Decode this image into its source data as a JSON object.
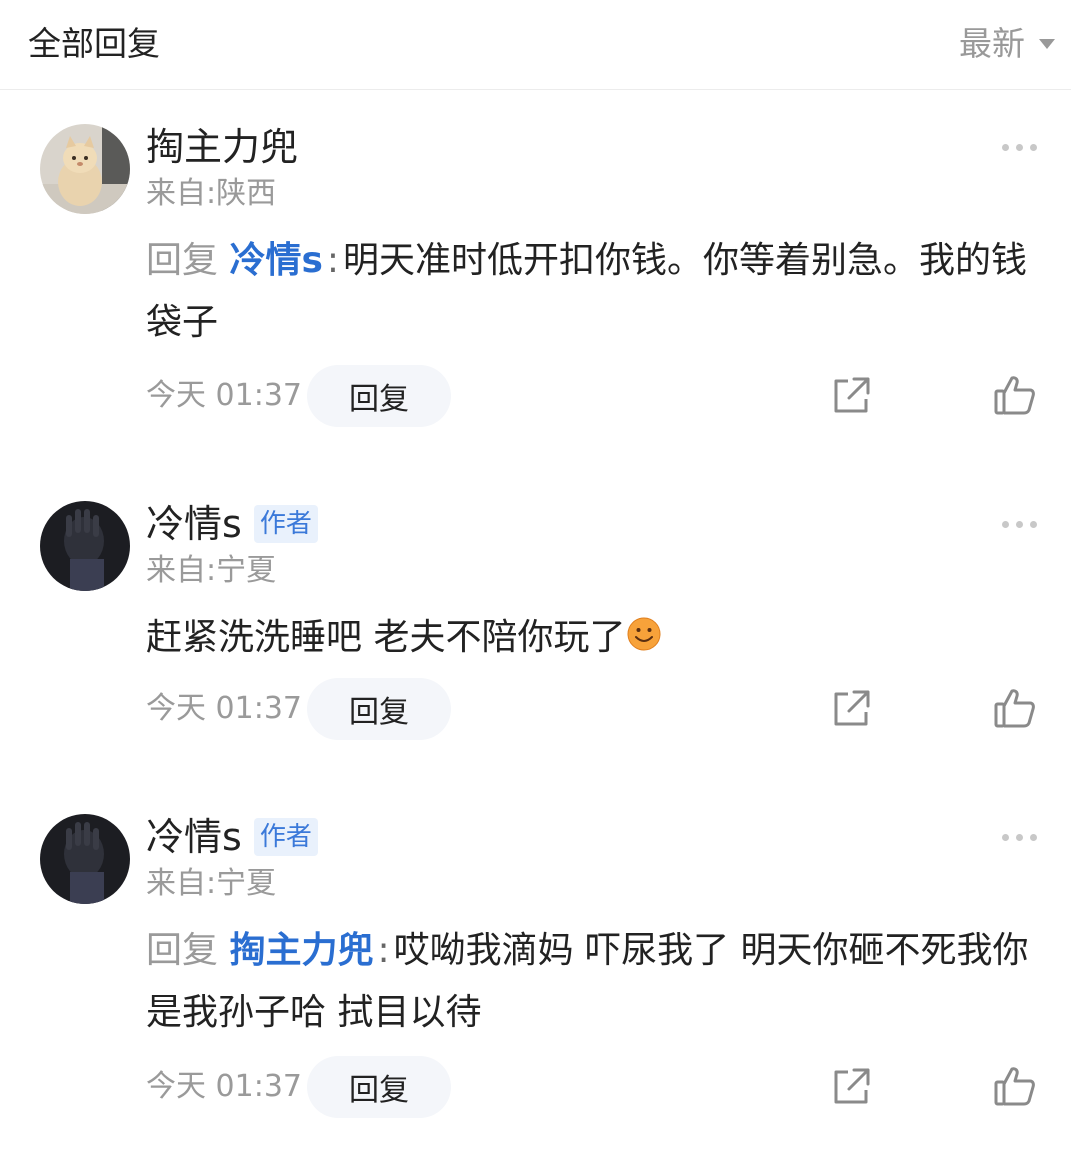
{
  "header": {
    "title": "全部回复",
    "sort_label": "最新"
  },
  "comments": [
    {
      "name": "掏主力兜",
      "location": "来自:陕西",
      "reply_prefix": "回复",
      "mention": "冷情s",
      "separator": ":",
      "text": "明天准时低开扣你钱。你等着别急。我的钱袋子",
      "time": "今天 01:37",
      "reply_label": "回复"
    },
    {
      "name": "冷情s",
      "badge": "作者",
      "location": "来自:宁夏",
      "text": "赶紧洗洗睡吧 老夫不陪你玩了",
      "emoji": "smile-emoji",
      "time": "今天 01:37",
      "reply_label": "回复"
    },
    {
      "name": "冷情s",
      "badge": "作者",
      "location": "来自:宁夏",
      "reply_prefix": "回复",
      "mention": "掏主力兜",
      "separator": ":",
      "text": "哎呦我滴妈 吓尿我了  明天你砸不死我你是我孙子哈 拭目以待",
      "time": "今天 01:37",
      "reply_label": "回复"
    }
  ],
  "icons": {
    "more": "more-dots-icon",
    "share": "share-icon",
    "like": "thumbs-up-icon"
  },
  "colors": {
    "mention": "#2a6ed1",
    "badge_bg": "#e9f1fc",
    "badge_text": "#3b79d9",
    "secondary_text": "#9a9a9a"
  }
}
